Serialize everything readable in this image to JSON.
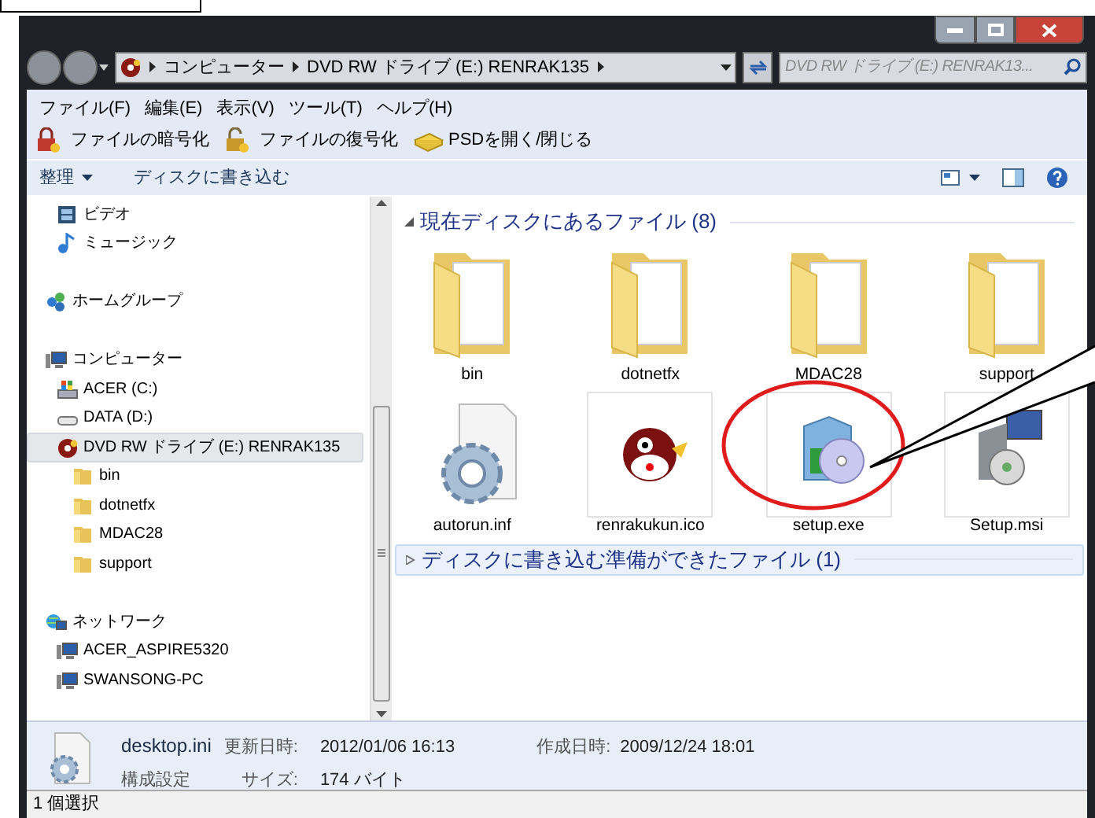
{
  "address_bar": {
    "path": [
      "コンピューター",
      "DVD RW ドライブ (E:) RENRAK135"
    ]
  },
  "search": {
    "placeholder": "DVD RW ドライブ (E:) RENRAK13..."
  },
  "menu": [
    "ファイル(F)",
    "編集(E)",
    "表示(V)",
    "ツール(T)",
    "ヘルプ(H)"
  ],
  "toolbar": [
    {
      "label": "ファイルの暗号化",
      "kind": "lock"
    },
    {
      "label": "ファイルの復号化",
      "kind": "unlock"
    },
    {
      "label": "PSDを開く/閉じる",
      "kind": "drive"
    }
  ],
  "command_bar": [
    {
      "label": "整理",
      "dropdown": true
    },
    {
      "label": "ディスクに書き込む",
      "dropdown": false
    }
  ],
  "sidebar": [
    {
      "children": [
        {
          "label": "ビデオ",
          "kind": "video",
          "selected": false
        },
        {
          "label": "ミュージック",
          "kind": "music",
          "selected": false
        }
      ]
    },
    {
      "label": "ホームグループ",
      "kind": "homegroup",
      "selected": false
    },
    {
      "label": "コンピューター",
      "kind": "computer",
      "selected": false,
      "children": [
        {
          "label": "ACER (C:)",
          "kind": "windisk",
          "selected": false
        },
        {
          "label": "DATA (D:)",
          "kind": "disk",
          "selected": false
        },
        {
          "label": "DVD RW ドライブ (E:) RENRAK135",
          "kind": "dvd",
          "selected": true,
          "children": [
            {
              "label": "bin",
              "kind": "folder",
              "selected": false
            },
            {
              "label": "dotnetfx",
              "kind": "folder",
              "selected": false
            },
            {
              "label": "MDAC28",
              "kind": "folder",
              "selected": false
            },
            {
              "label": "support",
              "kind": "folder",
              "selected": false
            }
          ]
        }
      ]
    },
    {
      "label": "ネットワーク",
      "kind": "network",
      "selected": false,
      "children": [
        {
          "label": "ACER_ASPIRE5320",
          "kind": "computer",
          "selected": false
        },
        {
          "label": "SWANSONG-PC",
          "kind": "computer",
          "selected": false
        }
      ]
    }
  ],
  "groups": [
    {
      "title": "現在ディスクにあるファイル (8)",
      "expanded": true,
      "files": [
        {
          "name": "bin",
          "kind": "folder"
        },
        {
          "name": "dotnetfx",
          "kind": "folder"
        },
        {
          "name": "MDAC28",
          "kind": "folder"
        },
        {
          "name": "support",
          "kind": "folder"
        },
        {
          "name": "autorun.inf",
          "kind": "settings"
        },
        {
          "name": "renrakukun.ico",
          "kind": "bird"
        },
        {
          "name": "setup.exe",
          "kind": "installer"
        },
        {
          "name": "Setup.msi",
          "kind": "msi"
        }
      ]
    },
    {
      "title": "ディスクに書き込む準備ができたファイル (1)",
      "expanded": false
    }
  ],
  "details": {
    "name": "desktop.ini",
    "type": "構成設定",
    "fields": [
      {
        "label": "更新日時:",
        "value": "2012/01/06 16:13"
      },
      {
        "label": "作成日時:",
        "value": "2009/12/24 18:01"
      },
      {
        "label": "サイズ:",
        "value": "174 バイト"
      }
    ]
  },
  "status_bar": "1 個選択"
}
